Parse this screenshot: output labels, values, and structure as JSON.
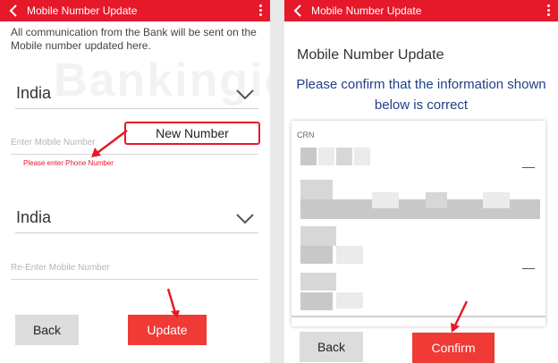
{
  "colors": {
    "accent": "#e6192b",
    "button_red": "#f03a35",
    "heading_blue": "#1f3f86"
  },
  "watermark": "Bankingidea.com",
  "left": {
    "header": {
      "title": "Mobile Number Update"
    },
    "info": "All communication from the Bank will be sent on the Mobile number updated here.",
    "country_1": "India",
    "mobile_placeholder": "Enter Mobile Number",
    "error": "Please enter Phone Number",
    "callout": "New Number",
    "country_2": "India",
    "reenter_placeholder": "Re-Enter Mobile Number",
    "back_label": "Back",
    "update_label": "Update"
  },
  "right": {
    "header": {
      "title": "Mobile Number Update"
    },
    "title": "Mobile Number Update",
    "subtitle": "Please confirm that the information shown below is correct",
    "field_label": "CRN",
    "back_label": "Back",
    "confirm_label": "Confirm"
  }
}
